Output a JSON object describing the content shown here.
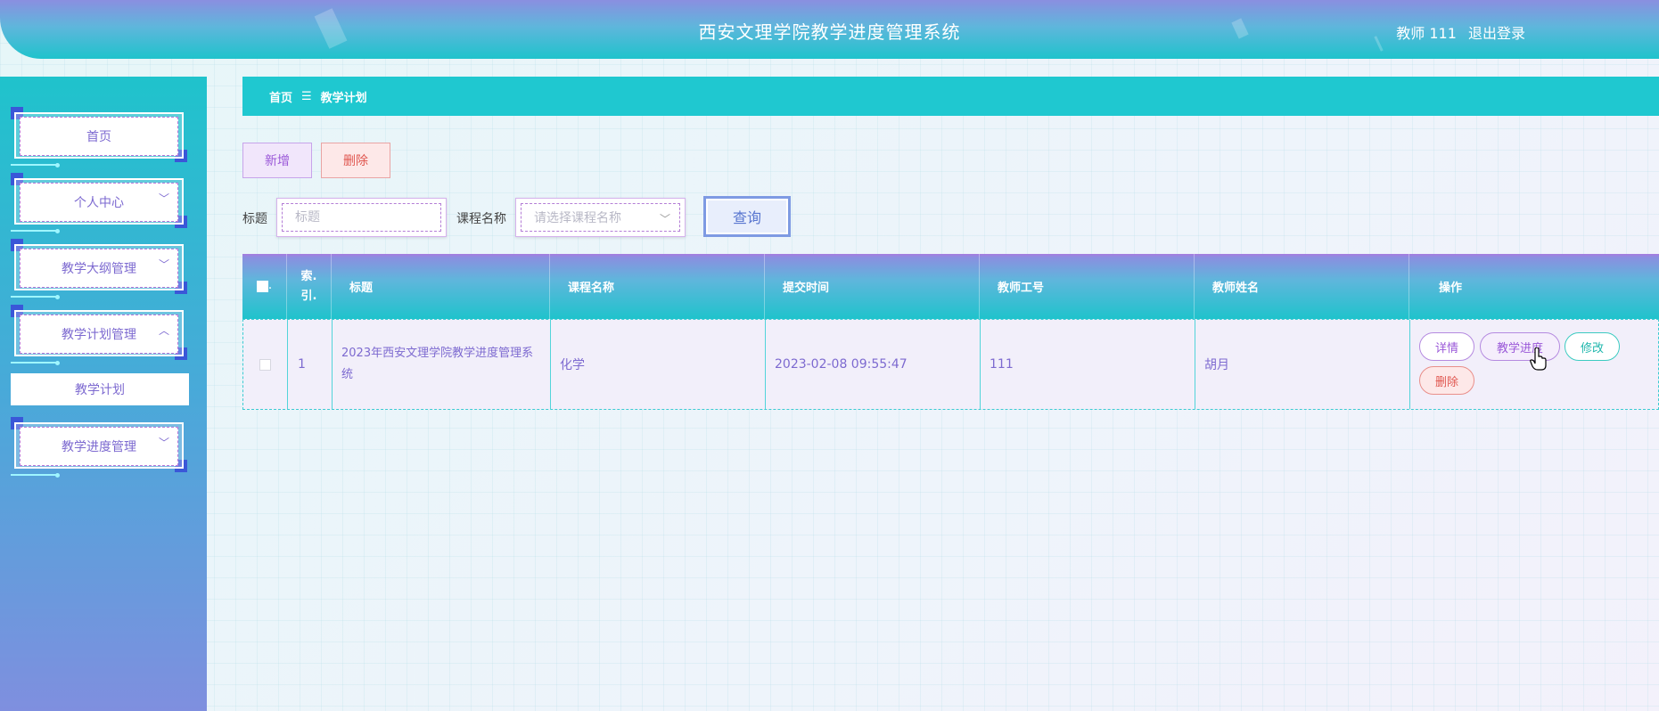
{
  "header": {
    "title": "西安文理学院教学进度管理系统",
    "user_label": "教师 111",
    "logout_label": "退出登录"
  },
  "sidebar": {
    "items": [
      {
        "label": "首页",
        "chevron": ""
      },
      {
        "label": "个人中心",
        "chevron": "﹀"
      },
      {
        "label": "教学大纲管理",
        "chevron": "﹀"
      },
      {
        "label": "教学计划管理",
        "chevron": "︿"
      },
      {
        "label": "教学进度管理",
        "chevron": "﹀"
      }
    ],
    "submenu": {
      "label": "教学计划"
    }
  },
  "breadcrumb": {
    "home": "首页",
    "separator": "☰",
    "current": "教学计划"
  },
  "toolbar": {
    "add_label": "新增",
    "delete_label": "删除"
  },
  "search": {
    "title_label": "标题",
    "title_placeholder": "标题",
    "course_label": "课程名称",
    "course_placeholder": "请选择课程名称",
    "query_label": "查询"
  },
  "table": {
    "columns": [
      "索.引.",
      "标题",
      "课程名称",
      "提交时间",
      "教师工号",
      "教师姓名",
      "操作"
    ],
    "index_line1": "索.",
    "index_line2": "引.",
    "rows": [
      {
        "index": "1",
        "title": "2023年西安文理学院教学进度管理系统",
        "course": "化学",
        "submit_time": "2023-02-08 09:55:47",
        "teacher_no": "111",
        "teacher_name": "胡月"
      }
    ],
    "actions": {
      "detail": "详情",
      "progress": "教学进度",
      "edit": "修改",
      "delete": "删除"
    }
  }
}
